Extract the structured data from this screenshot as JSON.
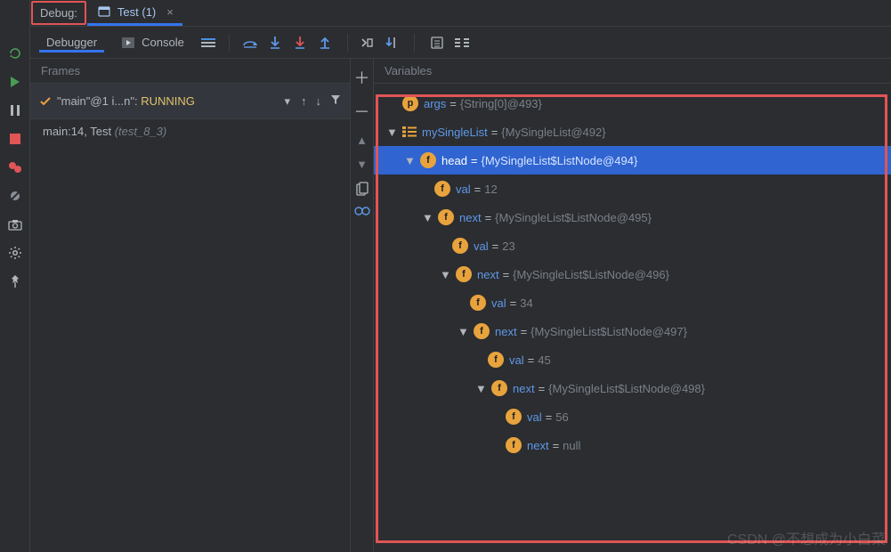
{
  "header": {
    "toolwindow": "Debug:",
    "tab": "Test (1)"
  },
  "toolbar": {
    "tabs": [
      "Debugger",
      "Console"
    ]
  },
  "frames": {
    "title": "Frames",
    "thread": {
      "name": "\"main\"@1 i...n\"",
      "state": "RUNNING"
    },
    "stack": [
      {
        "loc": "main:14, Test ",
        "pkg": "(test_8_3)"
      }
    ]
  },
  "variables": {
    "title": "Variables",
    "tree": [
      {
        "name": "args",
        "value": "{String[0]@493}"
      },
      {
        "name": "mySingleList",
        "value": "{MySingleList@492}",
        "children": [
          {
            "name": "head",
            "value": "{MySingleList$ListNode@494}",
            "children": [
              {
                "name": "val",
                "value": "12"
              },
              {
                "name": "next",
                "value": "{MySingleList$ListNode@495}"
              }
            ]
          }
        ]
      }
    ],
    "n2": {
      "val": {
        "name": "val",
        "value": "23"
      },
      "next": {
        "name": "next",
        "value": "{MySingleList$ListNode@496}"
      }
    },
    "n3": {
      "val": {
        "name": "val",
        "value": "34"
      },
      "next": {
        "name": "next",
        "value": "{MySingleList$ListNode@497}"
      }
    },
    "n4": {
      "val": {
        "name": "val",
        "value": "45"
      },
      "next": {
        "name": "next",
        "value": "{MySingleList$ListNode@498}"
      }
    },
    "n5": {
      "val": {
        "name": "val",
        "value": "56"
      },
      "next": {
        "name": "next",
        "value": "null"
      }
    }
  },
  "watermark": "CSDN @不想成为小白菜"
}
